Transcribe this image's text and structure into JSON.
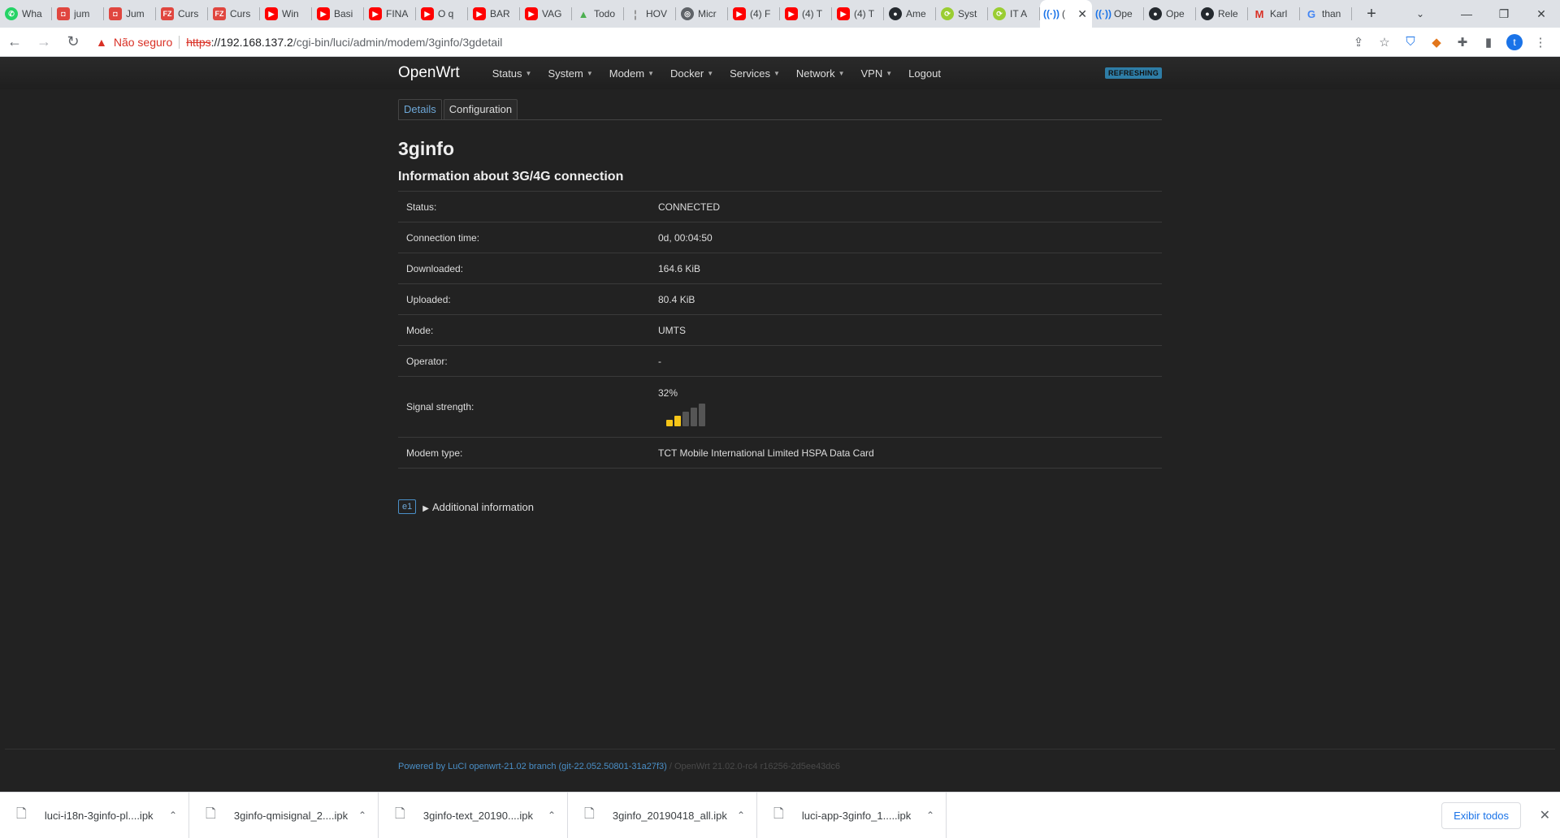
{
  "browser": {
    "tabs": [
      {
        "title": "Wha",
        "icon": "whatsapp-icon",
        "fav": "fav-whatsapp",
        "glyph": "✆"
      },
      {
        "title": "jum",
        "icon": "tab-favicon-icon",
        "fav": "fav-red",
        "glyph": "◘"
      },
      {
        "title": "Jum",
        "icon": "tab-favicon-icon",
        "fav": "fav-red",
        "glyph": "◘"
      },
      {
        "title": "Curs",
        "icon": "tab-favicon-icon",
        "fav": "fav-red",
        "glyph": "FZ"
      },
      {
        "title": "Curs",
        "icon": "tab-favicon-icon",
        "fav": "fav-red",
        "glyph": "FZ"
      },
      {
        "title": "Win",
        "icon": "youtube-icon",
        "fav": "fav-youtube",
        "glyph": "▶"
      },
      {
        "title": "Basi",
        "icon": "youtube-icon",
        "fav": "fav-youtube",
        "glyph": "▶"
      },
      {
        "title": "FINA",
        "icon": "youtube-icon",
        "fav": "fav-youtube",
        "glyph": "▶"
      },
      {
        "title": "O q",
        "icon": "youtube-icon",
        "fav": "fav-youtube",
        "glyph": "▶"
      },
      {
        "title": "BAR",
        "icon": "youtube-icon",
        "fav": "fav-youtube",
        "glyph": "▶"
      },
      {
        "title": "VAG",
        "icon": "youtube-icon",
        "fav": "fav-youtube",
        "glyph": "▶"
      },
      {
        "title": "Todo",
        "icon": "chart-icon",
        "fav": "fav-chart",
        "glyph": "▲"
      },
      {
        "title": "HOV",
        "icon": "document-icon",
        "fav": "fav-doc",
        "glyph": "¦"
      },
      {
        "title": "Micr",
        "icon": "globe-icon",
        "fav": "fav-grey",
        "glyph": "◎"
      },
      {
        "title": "(4) F",
        "icon": "youtube-icon",
        "fav": "fav-youtube",
        "glyph": "▶"
      },
      {
        "title": "(4) T",
        "icon": "youtube-icon",
        "fav": "fav-youtube",
        "glyph": "▶"
      },
      {
        "title": "(4) T",
        "icon": "youtube-icon",
        "fav": "fav-youtube",
        "glyph": "▶"
      },
      {
        "title": "Ame",
        "icon": "github-icon",
        "fav": "fav-github",
        "glyph": "●"
      },
      {
        "title": "Syst",
        "icon": "tab-favicon-icon",
        "fav": "fav-green",
        "glyph": "⟳"
      },
      {
        "title": "IT A",
        "icon": "tab-favicon-icon",
        "fav": "fav-green",
        "glyph": "⟳"
      },
      {
        "title": "(",
        "icon": "signal-icon",
        "fav": "fav-signal",
        "glyph": "((·))",
        "active": true
      },
      {
        "title": "Ope",
        "icon": "signal-icon",
        "fav": "fav-signal",
        "glyph": "((·))"
      },
      {
        "title": "Ope",
        "icon": "github-icon",
        "fav": "fav-github",
        "glyph": "●"
      },
      {
        "title": "Rele",
        "icon": "github-icon",
        "fav": "fav-github",
        "glyph": "●"
      },
      {
        "title": "Karl",
        "icon": "gmail-icon",
        "fav": "fav-gmail",
        "glyph": "M"
      },
      {
        "title": "than",
        "icon": "google-icon",
        "fav": "fav-google",
        "glyph": "G"
      }
    ],
    "not_secure_label": "Não seguro",
    "url_scheme": "https",
    "url_rest_host": "://192.168.137.2",
    "url_path": "/cgi-bin/luci/admin/modem/3ginfo/3gdetail",
    "profile_initial": "t"
  },
  "luci": {
    "brand": "OpenWrt",
    "menu": [
      "Status",
      "System",
      "Modem",
      "Docker",
      "Services",
      "Network",
      "VPN",
      "Logout"
    ],
    "refresh_badge": "REFRESHING",
    "tabs": {
      "details": "Details",
      "configuration": "Configuration"
    },
    "title": "3ginfo",
    "subtitle": "Information about 3G/4G connection",
    "rows": [
      {
        "label": "Status:",
        "value": "CONNECTED"
      },
      {
        "label": "Connection time:",
        "value": "0d, 00:04:50"
      },
      {
        "label": "Downloaded:",
        "value": "164.6 KiB"
      },
      {
        "label": "Uploaded:",
        "value": "80.4 KiB"
      },
      {
        "label": "Mode:",
        "value": "UMTS"
      },
      {
        "label": "Operator:",
        "value": "-"
      }
    ],
    "signal": {
      "label": "Signal strength:",
      "value": "32%",
      "level_fraction": 0.32,
      "bars_on": 2,
      "bars_total": 5,
      "on_color": "#f5c518"
    },
    "modem": {
      "label": "Modem type:",
      "value": "TCT Mobile International Limited HSPA Data Card"
    },
    "additional": {
      "button": "e1",
      "label": "Additional information"
    },
    "footer": {
      "powered": "Powered by LuCI openwrt-21.02 branch (git-22.052.50801-31a27f3)",
      "version": " / OpenWrt 21.02.0-rc4 r16256-2d5ee43dc6"
    }
  },
  "downloads": {
    "items": [
      "luci-i18n-3ginfo-pl....ipk",
      "3ginfo-qmisignal_2....ipk",
      "3ginfo-text_20190....ipk",
      "3ginfo_20190418_all.ipk",
      "luci-app-3ginfo_1.....ipk"
    ],
    "show_all": "Exibir todos"
  }
}
